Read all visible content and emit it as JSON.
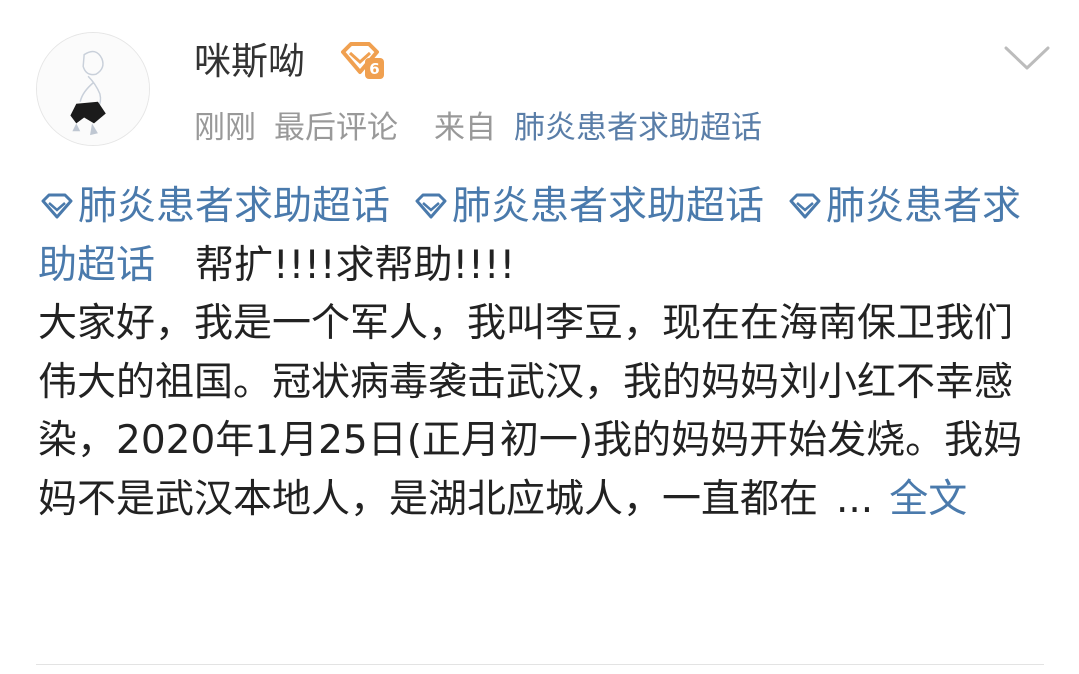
{
  "post": {
    "username": "咪斯呦",
    "badge_level": "6",
    "meta": {
      "time": "刚刚",
      "activity": "最后评论",
      "source_prefix": "来自",
      "source": "肺炎患者求助超话"
    },
    "topics": [
      "肺炎患者求助超话",
      "肺炎患者求助超话",
      "肺炎患者求助超话"
    ],
    "headline": "帮扩!!!!求帮助!!!!",
    "body": "大家好，我是一个军人，我叫李豆，现在在海南保卫我们伟大的祖国。冠状病毒袭击武汉，我的妈妈刘小红不幸感染，2020年1月25日(正月初一)我的妈妈开始发烧。我妈妈不是武汉本地人，是湖北应城人，一直都在",
    "ellipsis": "...",
    "more_label": "全文"
  },
  "colors": {
    "link": "#4a7aac",
    "meta": "#999999",
    "text": "#222222",
    "badge": "#f0a050"
  },
  "icons": {
    "badge": "vip-level-badge-icon",
    "topic": "super-topic-diamond-icon",
    "chevron": "chevron-down-icon"
  }
}
